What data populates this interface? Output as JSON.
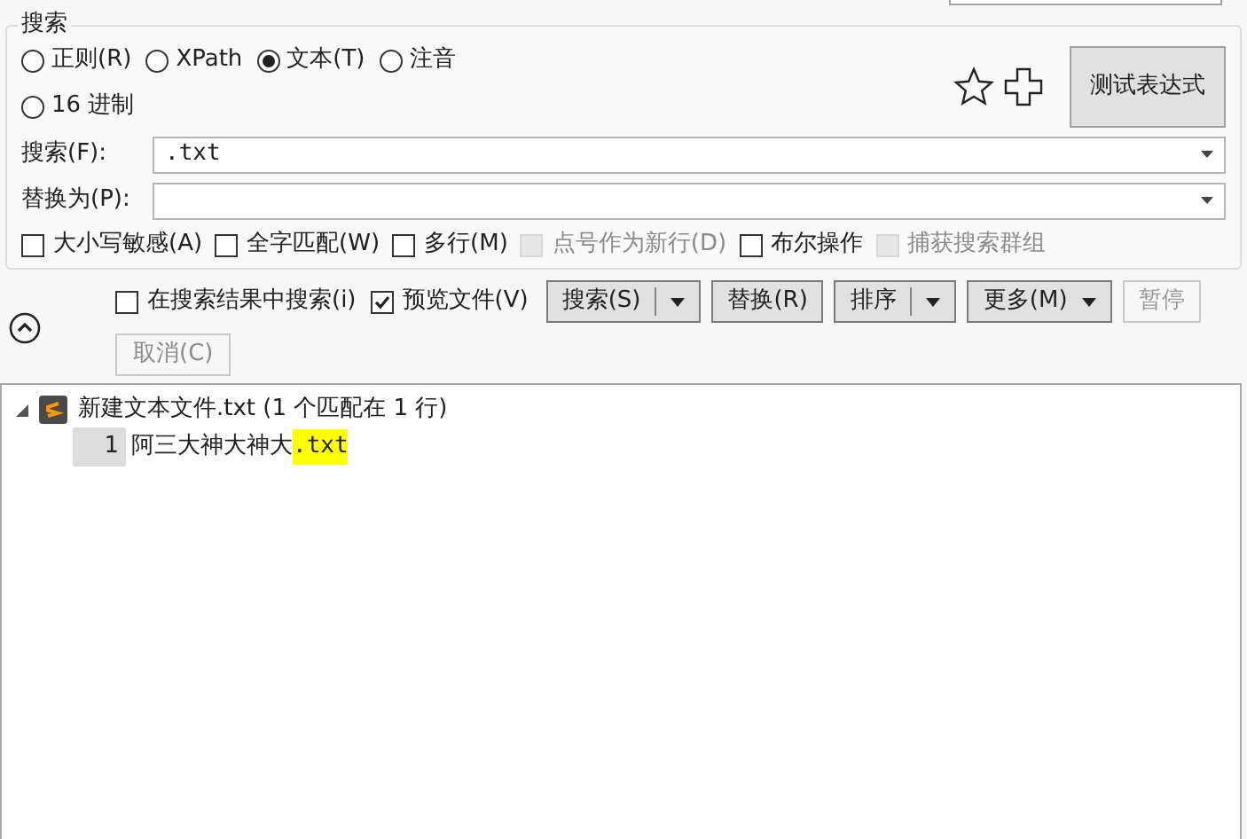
{
  "group_title": "搜索",
  "modes": [
    {
      "label": "正则(R)",
      "selected": false
    },
    {
      "label": "XPath",
      "selected": false
    },
    {
      "label": "文本(T)",
      "selected": true
    },
    {
      "label": "注音",
      "selected": false
    },
    {
      "label": "16 进制",
      "selected": false
    }
  ],
  "test_button": "测试表达式",
  "search_field": {
    "label": "搜索(F):",
    "value": ".txt"
  },
  "replace_field": {
    "label": "替换为(P):"
  },
  "options": [
    {
      "label": "大小写敏感(A)",
      "checked": false,
      "disabled": false
    },
    {
      "label": "全字匹配(W)",
      "checked": false,
      "disabled": false
    },
    {
      "label": "多行(M)",
      "checked": false,
      "disabled": false
    },
    {
      "label": "点号作为新行(D)",
      "checked": false,
      "disabled": true
    },
    {
      "label": "布尔操作",
      "checked": false,
      "disabled": false
    },
    {
      "label": "捕获搜索群组",
      "checked": false,
      "disabled": true
    }
  ],
  "toolbar_options": [
    {
      "label": "在搜索结果中搜索(i)",
      "checked": false
    },
    {
      "label": "预览文件(V)",
      "checked": true
    }
  ],
  "buttons": [
    {
      "label": "搜索(S)",
      "split": true,
      "disabled": false
    },
    {
      "label": "替换(R)",
      "split": false,
      "disabled": false
    },
    {
      "label": "排序",
      "split": true,
      "disabled": false
    },
    {
      "label": "更多(M)",
      "kind": "menu",
      "split": false,
      "disabled": false
    },
    {
      "label": "暂停",
      "split": false,
      "disabled": true
    }
  ],
  "cancel_button": {
    "label": "取消(C)",
    "disabled": true
  },
  "results": [
    {
      "file": "新建文本文件.txt (1 个匹配在 1 行)",
      "expanded": true,
      "matches": [
        {
          "line": "1",
          "before": "阿三大神大神大",
          "match": ".txt"
        }
      ]
    }
  ]
}
